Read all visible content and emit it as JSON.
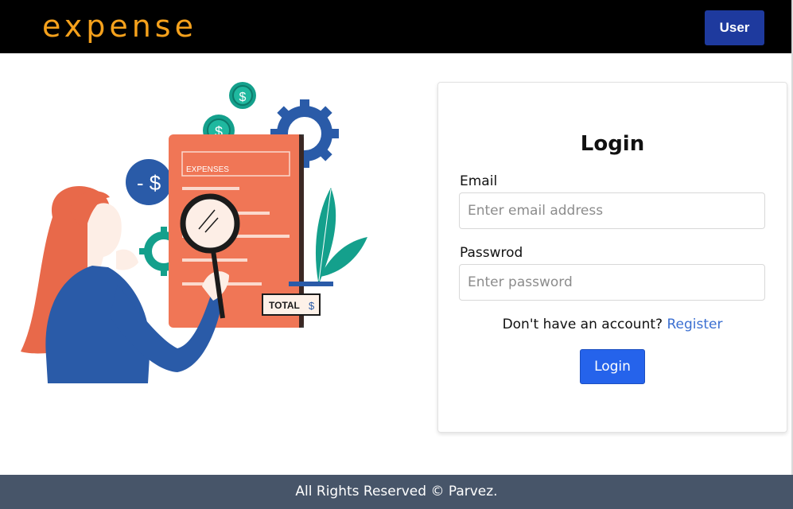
{
  "navbar": {
    "brand": "expense",
    "user_button": "User"
  },
  "illustration": {
    "expenses_label": "EXPENSES",
    "total_label": "TOTAL",
    "dollar_symbol": "$",
    "minus_dollar": "- $",
    "colors": {
      "orange": "#f07656",
      "blue": "#2a5ba8",
      "teal": "#14a08c",
      "hair": "#e8694a"
    }
  },
  "login": {
    "title": "Login",
    "email_label": "Email",
    "email_placeholder": "Enter email address",
    "password_label": "Passwrod",
    "password_placeholder": "Enter password",
    "no_account_text": "Don't have an account?",
    "register_link": "Register",
    "submit_label": "Login"
  },
  "footer": {
    "text": "All Rights Reserved © Parvez."
  },
  "colors": {
    "brand": "#f5a11c",
    "navbar_bg": "#000000",
    "user_button_bg": "#1e3a9e",
    "primary": "#2563eb",
    "link": "#3b6fd1",
    "footer_bg": "#475569"
  }
}
